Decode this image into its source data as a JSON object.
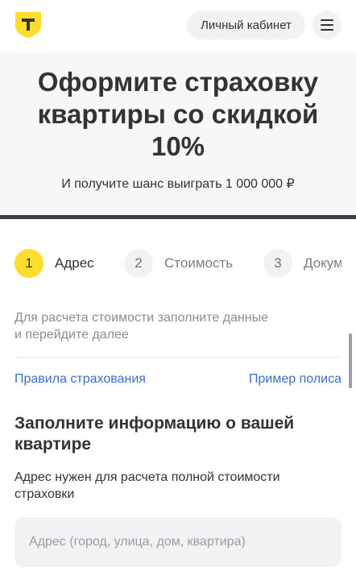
{
  "header": {
    "cabinet_label": "Личный кабинет",
    "logo_icon": "tinkoff-shield-logo",
    "menu_icon": "hamburger-menu-icon"
  },
  "hero": {
    "title_lines": [
      "Оформите страховку",
      "квартиры со скидкой",
      "10%"
    ],
    "subtitle": "И получите шанс выиграть 1 000 000 ₽"
  },
  "steps": [
    {
      "number": "1",
      "label": "Адрес",
      "active": true
    },
    {
      "number": "2",
      "label": "Стоимость",
      "active": false
    },
    {
      "number": "3",
      "label": "Документы",
      "active": false
    }
  ],
  "form": {
    "hint_lines": [
      "Для расчета стоимости заполните данные",
      "и перейдите далее"
    ],
    "links": {
      "rules": "Правила страхования",
      "example": "Пример полиса"
    },
    "section_title_lines": [
      "Заполните информацию о вашей",
      "квартире"
    ],
    "section_desc_lines": [
      "Адрес нужен для расчета полной стоимости",
      "страховки"
    ],
    "address": {
      "value": "",
      "placeholder": "Адрес (город, улица, дом, квартира)"
    }
  },
  "colors": {
    "accent": "#ffdd2d",
    "link": "#3c6fc4",
    "hero_bg": "#f6f7f8",
    "divider_bar": "#3a3d45"
  }
}
